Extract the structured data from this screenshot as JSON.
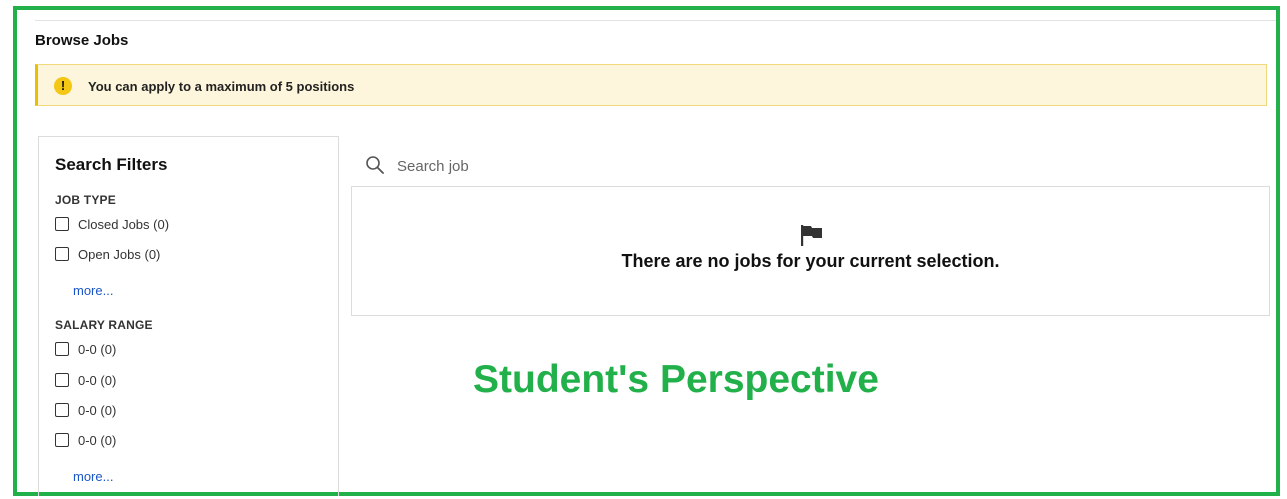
{
  "page": {
    "title": "Browse Jobs"
  },
  "alert": {
    "icon": "warning-icon",
    "text": "You can apply to a maximum of 5 positions"
  },
  "filters": {
    "title": "Search Filters",
    "job_type": {
      "heading": "JOB TYPE",
      "options": [
        {
          "label": "Closed Jobs (0)",
          "checked": false
        },
        {
          "label": "Open Jobs (0)",
          "checked": false
        }
      ],
      "more_label": "more..."
    },
    "salary_range": {
      "heading": "SALARY RANGE",
      "options": [
        {
          "label": "0-0 (0)",
          "checked": false
        },
        {
          "label": "0-0 (0)",
          "checked": false
        },
        {
          "label": "0-0 (0)",
          "checked": false
        },
        {
          "label": "0-0 (0)",
          "checked": false
        }
      ],
      "more_label": "more..."
    }
  },
  "search": {
    "placeholder": "Search job",
    "value": "",
    "icon": "search-icon"
  },
  "results": {
    "empty_icon": "flag-icon",
    "empty_message": "There are no jobs for your current selection."
  },
  "annotation": {
    "caption": "Student's Perspective",
    "color": "#22b04a"
  },
  "colors": {
    "frame": "#22b04a",
    "alert_bg": "#fdf6dc",
    "alert_accent": "#e8c000",
    "link": "#1a56c8"
  }
}
